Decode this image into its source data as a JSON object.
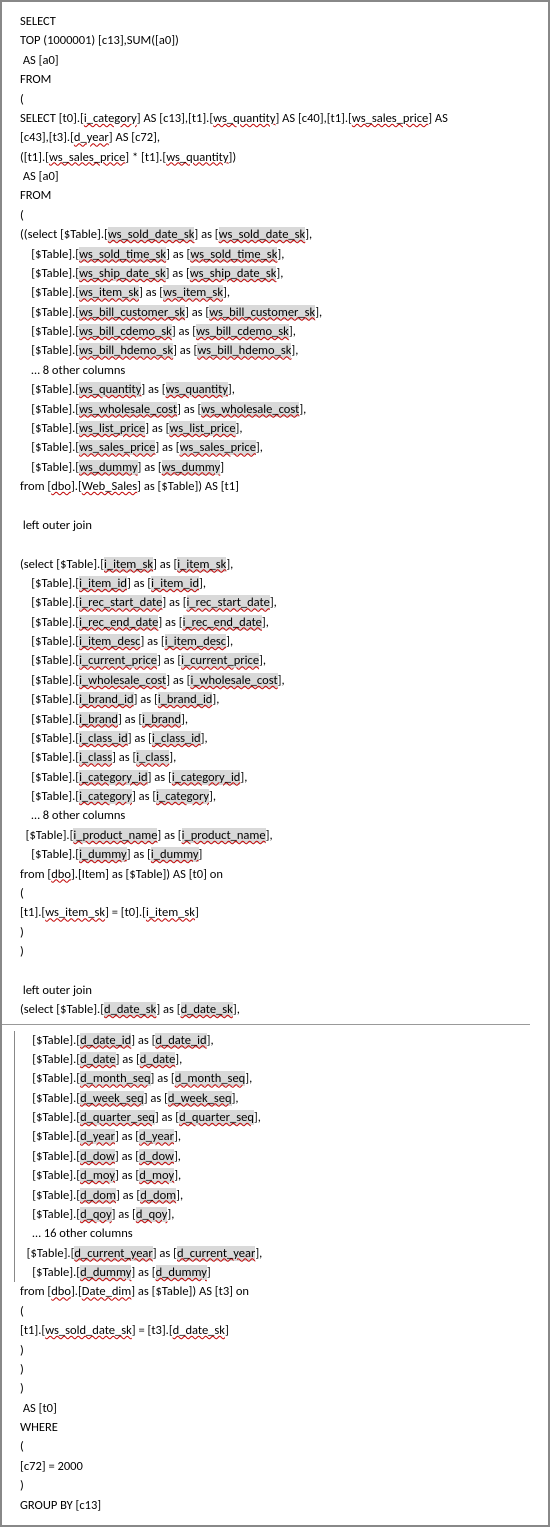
{
  "sql": {
    "l01": "SELECT",
    "l02": "TOP (1000001) [c13],SUM([a0])",
    "l03": " AS [a0]",
    "l04": "FROM",
    "l05": "(",
    "l06": "",
    "l07a": "SELECT [t0].[",
    "l07b": "i_category",
    "l07c": "] AS [c13],[t1].[",
    "l07d": "ws_quantity",
    "l07e": "] AS [c40],[t1].[",
    "l07f": "ws_sales_price",
    "l07g": "] AS",
    "l08a": "[c43],[t3].[",
    "l08b": "d_year",
    "l08c": "] AS [c72],",
    "l09a": "([t1].[",
    "l09b": "ws_sales_price",
    "l09c": "] * [t1].[",
    "l09d": "ws_quantity",
    "l09e": "])",
    "l10": " AS [a0]",
    "l11": "FROM",
    "l12": "(",
    "l13a": "((select [$Table].[",
    "l13b": "ws_sold_date_sk",
    "l13c": "] as [",
    "l13d": "ws_sold_date_sk",
    "l13e": "],",
    "l14a": "    [$Table].[",
    "l14b": "ws_sold_time_sk",
    "l14c": "] as [",
    "l14d": "ws_sold_time_sk",
    "l14e": "],",
    "l15a": "    [$Table].[",
    "l15b": "ws_ship_date_sk",
    "l15c": "] as [",
    "l15d": "ws_ship_date_sk",
    "l15e": "],",
    "l16a": "    [$Table].[",
    "l16b": "ws_item_sk",
    "l16c": "] as [",
    "l16d": "ws_item_sk",
    "l16e": "],",
    "l17a": "    [$Table].[",
    "l17b": "ws_bill_customer_sk",
    "l17c": "] as [",
    "l17d": "ws_bill_customer_sk",
    "l17e": "],",
    "l18a": "    [$Table].[",
    "l18b": "ws_bill_cdemo_sk",
    "l18c": "] as [",
    "l18d": "ws_bill_cdemo_sk",
    "l18e": "],",
    "l19a": "    [$Table].[",
    "l19b": "ws_bill_hdemo_sk",
    "l19c": "] as [",
    "l19d": "ws_bill_hdemo_sk",
    "l19e": "],",
    "l20": "    … 8 other columns",
    "l21a": "    [$Table].[",
    "l21b": "ws_quantity",
    "l21c": "] as [",
    "l21d": "ws_quantity",
    "l21e": "],",
    "l22a": "    [$Table].[",
    "l22b": "ws_wholesale_cost",
    "l22c": "] as [",
    "l22d": "ws_wholesale_cost",
    "l22e": "],",
    "l23a": "    [$Table].[",
    "l23b": "ws_list_price",
    "l23c": "] as [",
    "l23d": "ws_list_price",
    "l23e": "],",
    "l24a": "    [$Table].[",
    "l24b": "ws_sales_price",
    "l24c": "] as [",
    "l24d": "ws_sales_price",
    "l24e": "],",
    "l25a": "    [$Table].[",
    "l25b": "ws_dummy",
    "l25c": "] as [",
    "l25d": "ws_dummy",
    "l25e": "]",
    "l26a": "from [",
    "l26b": "dbo",
    "l26c": "].[",
    "l26d": "Web_Sales",
    "l26e": "] as [$Table]) AS [t1]",
    "l27": "",
    "l28": " left outer join",
    "l29": "",
    "l30a": "(select [$Table].[",
    "l30b": "i_item_sk",
    "l30c": "] as [",
    "l30d": "i_item_sk",
    "l30e": "],",
    "l31a": "    [$Table].[",
    "l31b": "i_item_id",
    "l31c": "] as [",
    "l31d": "i_item_id",
    "l31e": "],",
    "l32a": "    [$Table].[",
    "l32b": "i_rec_start_date",
    "l32c": "] as [",
    "l32d": "i_rec_start_date",
    "l32e": "],",
    "l33a": "    [$Table].[",
    "l33b": "i_rec_end_date",
    "l33c": "] as [",
    "l33d": "i_rec_end_date",
    "l33e": "],",
    "l34a": "    [$Table].[",
    "l34b": "i_item_desc",
    "l34c": "] as [",
    "l34d": "i_item_desc",
    "l34e": "],",
    "l35a": "    [$Table].[",
    "l35b": "i_current_price",
    "l35c": "] as [",
    "l35d": "i_current_price",
    "l35e": "],",
    "l36a": "    [$Table].[",
    "l36b": "i_wholesale_cost",
    "l36c": "] as [",
    "l36d": "i_wholesale_cost",
    "l36e": "],",
    "l37a": "    [$Table].[",
    "l37b": "i_brand_id",
    "l37c": "] as [",
    "l37d": "i_brand_id",
    "l37e": "],",
    "l38a": "    [$Table].[",
    "l38b": "i_brand",
    "l38c": "] as [",
    "l38d": "i_brand",
    "l38e": "],",
    "l39a": "    [$Table].[",
    "l39b": "i_class_id",
    "l39c": "] as [",
    "l39d": "i_class_id",
    "l39e": "],",
    "l40a": "    [$Table].[",
    "l40b": "i_class",
    "l40c": "] as [",
    "l40d": "i_class",
    "l40e": "],",
    "l41a": "    [$Table].[",
    "l41b": "i_category_id",
    "l41c": "] as [",
    "l41d": "i_category_id",
    "l41e": "],",
    "l42a": "    [$Table].[",
    "l42b": "i_category",
    "l42c": "] as [",
    "l42d": "i_category",
    "l42e": "],",
    "l43": "    … 8 other columns",
    "l44a": "  [$Table].[",
    "l44b": "i_product_name",
    "l44c": "] as [",
    "l44d": "i_product_name",
    "l44e": "],",
    "l45a": "    [$Table].[",
    "l45b": "i_dummy",
    "l45c": "] as [",
    "l45d": "i_dummy",
    "l45e": "]",
    "l46a": "from [",
    "l46b": "dbo",
    "l46c": "].[Item] as [$Table]) AS [t0] on",
    "l47": "(",
    "l48a": "[t1].[",
    "l48b": "ws_item_sk",
    "l48c": "] = [t0].[",
    "l48d": "i_item_sk",
    "l48e": "]",
    "l49": ")",
    "l50": ")",
    "l51": "",
    "l52": " left outer join",
    "l53a": "(select [$Table].[",
    "l53b": "d_date_sk",
    "l53c": "] as [",
    "l53d": "d_date_sk",
    "l53e": "],",
    "l55a": "    [$Table].[",
    "l55b": "d_date_id",
    "l55c": "] as [",
    "l55d": "d_date_id",
    "l55e": "],",
    "l56a": "    [$Table].[",
    "l56b": "d_date",
    "l56c": "] as [",
    "l56d": "d_date",
    "l56e": "],",
    "l57a": "    [$Table].[",
    "l57b": "d_month_seq",
    "l57c": "] as [",
    "l57d": "d_month_seq",
    "l57e": "],",
    "l58a": "    [$Table].[",
    "l58b": "d_week_seq",
    "l58c": "] as [",
    "l58d": "d_week_seq",
    "l58e": "],",
    "l59a": "    [$Table].[",
    "l59b": "d_quarter_seq",
    "l59c": "] as [",
    "l59d": "d_quarter_seq",
    "l59e": "],",
    "l60a": "    [$Table].[",
    "l60b": "d_year",
    "l60c": "] as [",
    "l60d": "d_year",
    "l60e": "],",
    "l61a": "    [$Table].[",
    "l61b": "d_dow",
    "l61c": "] as [",
    "l61d": "d_dow",
    "l61e": "],",
    "l62a": "    [$Table].[",
    "l62b": "d_moy",
    "l62c": "] as [",
    "l62d": "d_moy",
    "l62e": "],",
    "l63a": "    [$Table].[",
    "l63b": "d_dom",
    "l63c": "] as [",
    "l63d": "d_dom",
    "l63e": "],",
    "l64a": "    [$Table].[",
    "l64b": "d_qoy",
    "l64c": "] as [",
    "l64d": "d_qoy",
    "l64e": "],",
    "l65": "    … 16 other columns",
    "l66a": "  [$Table].[",
    "l66b": "d_current_year",
    "l66c": "] as [",
    "l66d": "d_current_year",
    "l66e": "],",
    "l67a": "    [$Table].[",
    "l67b": "d_dummy",
    "l67c": "] as [",
    "l67d": "d_dummy",
    "l67e": "]",
    "l68a": "from [",
    "l68b": "dbo",
    "l68c": "].[",
    "l68d": "Date_dim",
    "l68e": "] as [$Table]) AS [t3] on",
    "l69": "(",
    "l70a": "[t1].[",
    "l70b": "ws_sold_date_sk",
    "l70c": "] = [t3].[",
    "l70d": "d_date_sk",
    "l70e": "]",
    "l71": ")",
    "l72": ")",
    "l73": ")",
    "l74": " AS [t0]",
    "l75": "WHERE",
    "l76": "(",
    "l77": "[c72] = 2000",
    "l78": ")",
    "l79": "GROUP BY [c13]"
  }
}
